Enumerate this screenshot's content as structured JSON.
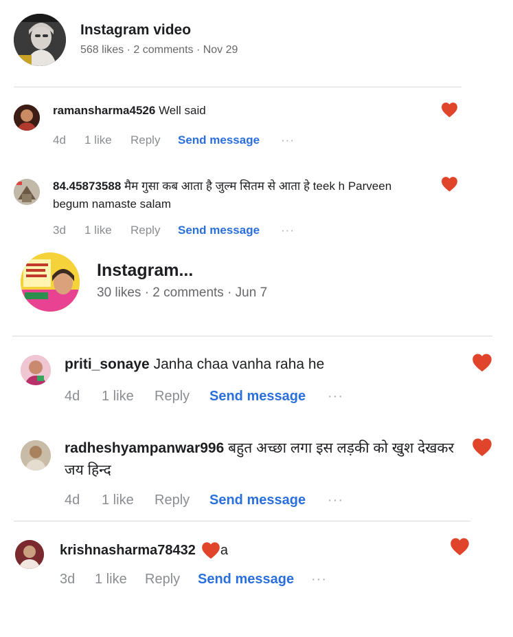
{
  "posts": [
    {
      "title": "Instagram video",
      "meta": "568 likes · 2 comments · Nov 29",
      "comments": [
        {
          "user": "ramansharma4526",
          "text": "Well said",
          "time": "4d",
          "likes": "1 like",
          "reply": "Reply",
          "send": "Send message",
          "more": "···"
        },
        {
          "user": "84.45873588",
          "text": "मैम गुसा कब आता है जुल्म सितम से आता हे teek h Parveen begum namaste salam",
          "time": "3d",
          "likes": "1 like",
          "reply": "Reply",
          "send": "Send message",
          "more": "···"
        }
      ]
    },
    {
      "title": "Instagram...",
      "meta": "30 likes · 2 comments · Jun 7",
      "comments": [
        {
          "user": "priti_sonaye",
          "text": "Janha chaa vanha raha he",
          "time": "4d",
          "likes": "1 like",
          "reply": "Reply",
          "send": "Send message",
          "more": "···"
        },
        {
          "user": "radheshyampanwar996",
          "text": "बहुत अच्छा लगा इस लड़की को खुश देखकर जय हिन्द",
          "time": "4d",
          "likes": "1 like",
          "reply": "Reply",
          "send": "Send message",
          "more": "···"
        },
        {
          "user": "krishnasharma78432",
          "text": "a",
          "time": "3d",
          "likes": "1 like",
          "reply": "Reply",
          "send": "Send message",
          "more": "···"
        }
      ]
    }
  ],
  "colors": {
    "heart": "#e0442a",
    "link": "#2a6fdb",
    "muted": "#8a8d91"
  },
  "icons": {
    "like": "heart-icon",
    "more": "more-options-icon"
  }
}
